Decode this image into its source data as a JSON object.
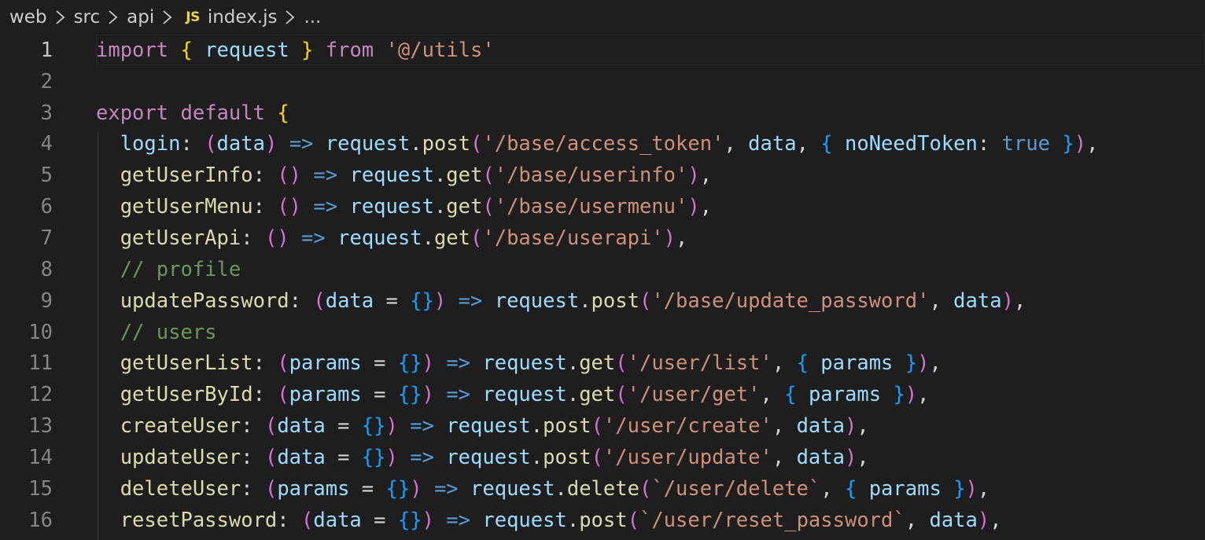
{
  "breadcrumb": {
    "items": [
      "web",
      "src",
      "api"
    ],
    "file_icon": "JS",
    "file": "index.js",
    "more": "..."
  },
  "editor": {
    "active_line": 1,
    "lines": [
      {
        "num": "1",
        "tokens": [
          {
            "t": "import",
            "c": "kw"
          },
          {
            "t": " ",
            "c": "op"
          },
          {
            "t": "{",
            "c": "b1"
          },
          {
            "t": " ",
            "c": "op"
          },
          {
            "t": "request",
            "c": "var"
          },
          {
            "t": " ",
            "c": "op"
          },
          {
            "t": "}",
            "c": "b1"
          },
          {
            "t": " ",
            "c": "op"
          },
          {
            "t": "from",
            "c": "kw"
          },
          {
            "t": " ",
            "c": "op"
          },
          {
            "t": "'@/utils'",
            "c": "str"
          }
        ]
      },
      {
        "num": "2",
        "tokens": []
      },
      {
        "num": "3",
        "tokens": [
          {
            "t": "export",
            "c": "kw"
          },
          {
            "t": " ",
            "c": "op"
          },
          {
            "t": "default",
            "c": "kw"
          },
          {
            "t": " ",
            "c": "op"
          },
          {
            "t": "{",
            "c": "b1"
          }
        ]
      },
      {
        "num": "4",
        "tokens": [
          {
            "t": "  login",
            "c": "var"
          },
          {
            "t": ": ",
            "c": "op"
          },
          {
            "t": "(",
            "c": "b2"
          },
          {
            "t": "data",
            "c": "var"
          },
          {
            "t": ")",
            "c": "b2"
          },
          {
            "t": " ",
            "c": "op"
          },
          {
            "t": "=>",
            "c": "arrow"
          },
          {
            "t": " ",
            "c": "op"
          },
          {
            "t": "request",
            "c": "var"
          },
          {
            "t": ".",
            "c": "op"
          },
          {
            "t": "post",
            "c": "fn"
          },
          {
            "t": "(",
            "c": "b2"
          },
          {
            "t": "'/base/access_token'",
            "c": "str"
          },
          {
            "t": ", ",
            "c": "op"
          },
          {
            "t": "data",
            "c": "var"
          },
          {
            "t": ", ",
            "c": "op"
          },
          {
            "t": "{",
            "c": "b3"
          },
          {
            "t": " ",
            "c": "op"
          },
          {
            "t": "noNeedToken",
            "c": "var"
          },
          {
            "t": ": ",
            "c": "op"
          },
          {
            "t": "true",
            "c": "kwb"
          },
          {
            "t": " ",
            "c": "op"
          },
          {
            "t": "}",
            "c": "b3"
          },
          {
            "t": ")",
            "c": "b2"
          },
          {
            "t": ",",
            "c": "op"
          }
        ]
      },
      {
        "num": "5",
        "tokens": [
          {
            "t": "  getUserInfo",
            "c": "fn"
          },
          {
            "t": ": ",
            "c": "op"
          },
          {
            "t": "()",
            "c": "b2"
          },
          {
            "t": " ",
            "c": "op"
          },
          {
            "t": "=>",
            "c": "arrow"
          },
          {
            "t": " ",
            "c": "op"
          },
          {
            "t": "request",
            "c": "var"
          },
          {
            "t": ".",
            "c": "op"
          },
          {
            "t": "get",
            "c": "fn"
          },
          {
            "t": "(",
            "c": "b2"
          },
          {
            "t": "'/base/userinfo'",
            "c": "str"
          },
          {
            "t": ")",
            "c": "b2"
          },
          {
            "t": ",",
            "c": "op"
          }
        ]
      },
      {
        "num": "6",
        "tokens": [
          {
            "t": "  getUserMenu",
            "c": "fn"
          },
          {
            "t": ": ",
            "c": "op"
          },
          {
            "t": "()",
            "c": "b2"
          },
          {
            "t": " ",
            "c": "op"
          },
          {
            "t": "=>",
            "c": "arrow"
          },
          {
            "t": " ",
            "c": "op"
          },
          {
            "t": "request",
            "c": "var"
          },
          {
            "t": ".",
            "c": "op"
          },
          {
            "t": "get",
            "c": "fn"
          },
          {
            "t": "(",
            "c": "b2"
          },
          {
            "t": "'/base/usermenu'",
            "c": "str"
          },
          {
            "t": ")",
            "c": "b2"
          },
          {
            "t": ",",
            "c": "op"
          }
        ]
      },
      {
        "num": "7",
        "tokens": [
          {
            "t": "  getUserApi",
            "c": "fn"
          },
          {
            "t": ": ",
            "c": "op"
          },
          {
            "t": "()",
            "c": "b2"
          },
          {
            "t": " ",
            "c": "op"
          },
          {
            "t": "=>",
            "c": "arrow"
          },
          {
            "t": " ",
            "c": "op"
          },
          {
            "t": "request",
            "c": "var"
          },
          {
            "t": ".",
            "c": "op"
          },
          {
            "t": "get",
            "c": "fn"
          },
          {
            "t": "(",
            "c": "b2"
          },
          {
            "t": "'/base/userapi'",
            "c": "str"
          },
          {
            "t": ")",
            "c": "b2"
          },
          {
            "t": ",",
            "c": "op"
          }
        ]
      },
      {
        "num": "8",
        "tokens": [
          {
            "t": "  // profile",
            "c": "cmt"
          }
        ]
      },
      {
        "num": "9",
        "tokens": [
          {
            "t": "  updatePassword",
            "c": "fn"
          },
          {
            "t": ": ",
            "c": "op"
          },
          {
            "t": "(",
            "c": "b2"
          },
          {
            "t": "data",
            "c": "var"
          },
          {
            "t": " = ",
            "c": "op"
          },
          {
            "t": "{}",
            "c": "b3"
          },
          {
            "t": ")",
            "c": "b2"
          },
          {
            "t": " ",
            "c": "op"
          },
          {
            "t": "=>",
            "c": "arrow"
          },
          {
            "t": " ",
            "c": "op"
          },
          {
            "t": "request",
            "c": "var"
          },
          {
            "t": ".",
            "c": "op"
          },
          {
            "t": "post",
            "c": "fn"
          },
          {
            "t": "(",
            "c": "b2"
          },
          {
            "t": "'/base/update_password'",
            "c": "str"
          },
          {
            "t": ", ",
            "c": "op"
          },
          {
            "t": "data",
            "c": "var"
          },
          {
            "t": ")",
            "c": "b2"
          },
          {
            "t": ",",
            "c": "op"
          }
        ]
      },
      {
        "num": "10",
        "tokens": [
          {
            "t": "  // users",
            "c": "cmt"
          }
        ]
      },
      {
        "num": "11",
        "tokens": [
          {
            "t": "  getUserList",
            "c": "fn"
          },
          {
            "t": ": ",
            "c": "op"
          },
          {
            "t": "(",
            "c": "b2"
          },
          {
            "t": "params",
            "c": "var"
          },
          {
            "t": " = ",
            "c": "op"
          },
          {
            "t": "{}",
            "c": "b3"
          },
          {
            "t": ")",
            "c": "b2"
          },
          {
            "t": " ",
            "c": "op"
          },
          {
            "t": "=>",
            "c": "arrow"
          },
          {
            "t": " ",
            "c": "op"
          },
          {
            "t": "request",
            "c": "var"
          },
          {
            "t": ".",
            "c": "op"
          },
          {
            "t": "get",
            "c": "fn"
          },
          {
            "t": "(",
            "c": "b2"
          },
          {
            "t": "'/user/list'",
            "c": "str"
          },
          {
            "t": ", ",
            "c": "op"
          },
          {
            "t": "{",
            "c": "b3"
          },
          {
            "t": " ",
            "c": "op"
          },
          {
            "t": "params",
            "c": "var"
          },
          {
            "t": " ",
            "c": "op"
          },
          {
            "t": "}",
            "c": "b3"
          },
          {
            "t": ")",
            "c": "b2"
          },
          {
            "t": ",",
            "c": "op"
          }
        ]
      },
      {
        "num": "12",
        "tokens": [
          {
            "t": "  getUserById",
            "c": "fn"
          },
          {
            "t": ": ",
            "c": "op"
          },
          {
            "t": "(",
            "c": "b2"
          },
          {
            "t": "params",
            "c": "var"
          },
          {
            "t": " = ",
            "c": "op"
          },
          {
            "t": "{}",
            "c": "b3"
          },
          {
            "t": ")",
            "c": "b2"
          },
          {
            "t": " ",
            "c": "op"
          },
          {
            "t": "=>",
            "c": "arrow"
          },
          {
            "t": " ",
            "c": "op"
          },
          {
            "t": "request",
            "c": "var"
          },
          {
            "t": ".",
            "c": "op"
          },
          {
            "t": "get",
            "c": "fn"
          },
          {
            "t": "(",
            "c": "b2"
          },
          {
            "t": "'/user/get'",
            "c": "str"
          },
          {
            "t": ", ",
            "c": "op"
          },
          {
            "t": "{",
            "c": "b3"
          },
          {
            "t": " ",
            "c": "op"
          },
          {
            "t": "params",
            "c": "var"
          },
          {
            "t": " ",
            "c": "op"
          },
          {
            "t": "}",
            "c": "b3"
          },
          {
            "t": ")",
            "c": "b2"
          },
          {
            "t": ",",
            "c": "op"
          }
        ]
      },
      {
        "num": "13",
        "tokens": [
          {
            "t": "  createUser",
            "c": "fn"
          },
          {
            "t": ": ",
            "c": "op"
          },
          {
            "t": "(",
            "c": "b2"
          },
          {
            "t": "data",
            "c": "var"
          },
          {
            "t": " = ",
            "c": "op"
          },
          {
            "t": "{}",
            "c": "b3"
          },
          {
            "t": ")",
            "c": "b2"
          },
          {
            "t": " ",
            "c": "op"
          },
          {
            "t": "=>",
            "c": "arrow"
          },
          {
            "t": " ",
            "c": "op"
          },
          {
            "t": "request",
            "c": "var"
          },
          {
            "t": ".",
            "c": "op"
          },
          {
            "t": "post",
            "c": "fn"
          },
          {
            "t": "(",
            "c": "b2"
          },
          {
            "t": "'/user/create'",
            "c": "str"
          },
          {
            "t": ", ",
            "c": "op"
          },
          {
            "t": "data",
            "c": "var"
          },
          {
            "t": ")",
            "c": "b2"
          },
          {
            "t": ",",
            "c": "op"
          }
        ]
      },
      {
        "num": "14",
        "tokens": [
          {
            "t": "  updateUser",
            "c": "fn"
          },
          {
            "t": ": ",
            "c": "op"
          },
          {
            "t": "(",
            "c": "b2"
          },
          {
            "t": "data",
            "c": "var"
          },
          {
            "t": " = ",
            "c": "op"
          },
          {
            "t": "{}",
            "c": "b3"
          },
          {
            "t": ")",
            "c": "b2"
          },
          {
            "t": " ",
            "c": "op"
          },
          {
            "t": "=>",
            "c": "arrow"
          },
          {
            "t": " ",
            "c": "op"
          },
          {
            "t": "request",
            "c": "var"
          },
          {
            "t": ".",
            "c": "op"
          },
          {
            "t": "post",
            "c": "fn"
          },
          {
            "t": "(",
            "c": "b2"
          },
          {
            "t": "'/user/update'",
            "c": "str"
          },
          {
            "t": ", ",
            "c": "op"
          },
          {
            "t": "data",
            "c": "var"
          },
          {
            "t": ")",
            "c": "b2"
          },
          {
            "t": ",",
            "c": "op"
          }
        ]
      },
      {
        "num": "15",
        "tokens": [
          {
            "t": "  deleteUser",
            "c": "fn"
          },
          {
            "t": ": ",
            "c": "op"
          },
          {
            "t": "(",
            "c": "b2"
          },
          {
            "t": "params",
            "c": "var"
          },
          {
            "t": " = ",
            "c": "op"
          },
          {
            "t": "{}",
            "c": "b3"
          },
          {
            "t": ")",
            "c": "b2"
          },
          {
            "t": " ",
            "c": "op"
          },
          {
            "t": "=>",
            "c": "arrow"
          },
          {
            "t": " ",
            "c": "op"
          },
          {
            "t": "request",
            "c": "var"
          },
          {
            "t": ".",
            "c": "op"
          },
          {
            "t": "delete",
            "c": "fn"
          },
          {
            "t": "(",
            "c": "b2"
          },
          {
            "t": "`/user/delete`",
            "c": "str"
          },
          {
            "t": ", ",
            "c": "op"
          },
          {
            "t": "{",
            "c": "b3"
          },
          {
            "t": " ",
            "c": "op"
          },
          {
            "t": "params",
            "c": "var"
          },
          {
            "t": " ",
            "c": "op"
          },
          {
            "t": "}",
            "c": "b3"
          },
          {
            "t": ")",
            "c": "b2"
          },
          {
            "t": ",",
            "c": "op"
          }
        ]
      },
      {
        "num": "16",
        "tokens": [
          {
            "t": "  resetPassword",
            "c": "fn"
          },
          {
            "t": ": ",
            "c": "op"
          },
          {
            "t": "(",
            "c": "b2"
          },
          {
            "t": "data",
            "c": "var"
          },
          {
            "t": " = ",
            "c": "op"
          },
          {
            "t": "{}",
            "c": "b3"
          },
          {
            "t": ")",
            "c": "b2"
          },
          {
            "t": " ",
            "c": "op"
          },
          {
            "t": "=>",
            "c": "arrow"
          },
          {
            "t": " ",
            "c": "op"
          },
          {
            "t": "request",
            "c": "var"
          },
          {
            "t": ".",
            "c": "op"
          },
          {
            "t": "post",
            "c": "fn"
          },
          {
            "t": "(",
            "c": "b2"
          },
          {
            "t": "`/user/reset_password`",
            "c": "str"
          },
          {
            "t": ", ",
            "c": "op"
          },
          {
            "t": "data",
            "c": "var"
          },
          {
            "t": ")",
            "c": "b2"
          },
          {
            "t": ",",
            "c": "op"
          }
        ]
      }
    ]
  }
}
